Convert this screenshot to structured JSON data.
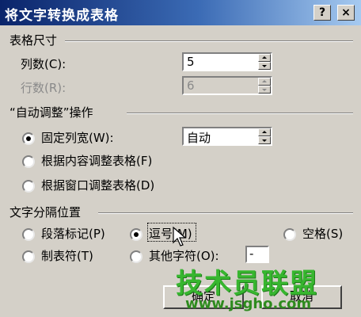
{
  "dialog": {
    "title": "将文字转换成表格",
    "help_label": "?",
    "close_label": "×"
  },
  "table_size": {
    "group_title": "表格尺寸",
    "columns_label": "列数(C):",
    "columns_value": "5",
    "rows_label": "行数(R):",
    "rows_value": "6"
  },
  "autofit": {
    "group_title": "“自动调整”操作",
    "fixed_width_label": "固定列宽(W):",
    "fixed_width_value": "自动",
    "fit_content_label": "根据内容调整表格(F)",
    "fit_window_label": "根据窗口调整表格(D)",
    "selected": "fixed_width"
  },
  "separator": {
    "group_title": "文字分隔位置",
    "paragraph_label": "段落标记(P)",
    "comma_label": "逗号(M)",
    "space_label": "空格(S)",
    "tab_label": "制表符(T)",
    "other_label": "其他字符(O):",
    "other_value": "-",
    "selected": "comma"
  },
  "buttons": {
    "ok_label": "确定",
    "cancel_label": "取消"
  },
  "watermark": {
    "site_name": "技术员联盟",
    "url": "www.jsgho.com"
  },
  "colors": {
    "titlebar_start": "#0a246a",
    "titlebar_end": "#a6caf0",
    "dialog_face": "#d4d0c8",
    "watermark_green": "#37b62f"
  }
}
